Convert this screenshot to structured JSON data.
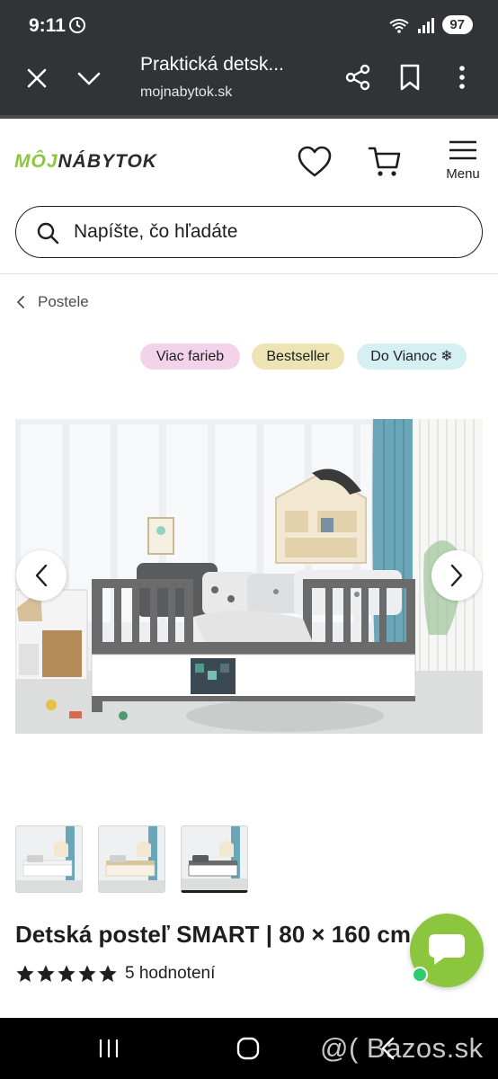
{
  "status_bar": {
    "time": "9:11",
    "battery": "97",
    "icons": [
      "alarm-icon",
      "wifi-icon",
      "signal-icon",
      "battery-icon"
    ]
  },
  "custom_tab": {
    "title": "Praktická detsk...",
    "url": "mojnabytok.sk",
    "icons": [
      "close-icon",
      "chevron-down-icon",
      "share-icon",
      "bookmark-icon",
      "more-vert-icon"
    ]
  },
  "header": {
    "logo_part1": "MÔJ",
    "logo_part2": "NÁBYTOK",
    "menu_label": "Menu",
    "icons": [
      "heart-icon",
      "cart-icon",
      "hamburger-icon"
    ]
  },
  "search": {
    "placeholder": "Napíšte, čo hľadáte"
  },
  "breadcrumb": {
    "label": "Postele"
  },
  "badges": [
    {
      "label": "Viac farieb",
      "color": "#f3d3ea"
    },
    {
      "label": "Bestseller",
      "color": "#ede4b4"
    },
    {
      "label": "Do Vianoc ❄",
      "color": "#d6eff2"
    }
  ],
  "product": {
    "title": "Detská posteľ SMART | 80 × 160 cm",
    "rating": 5,
    "reviews": "5 hodnotení"
  },
  "colors": {
    "brand_green": "#8cc63f",
    "header_dark": "#303437"
  },
  "watermark": "@( Bazos.sk"
}
